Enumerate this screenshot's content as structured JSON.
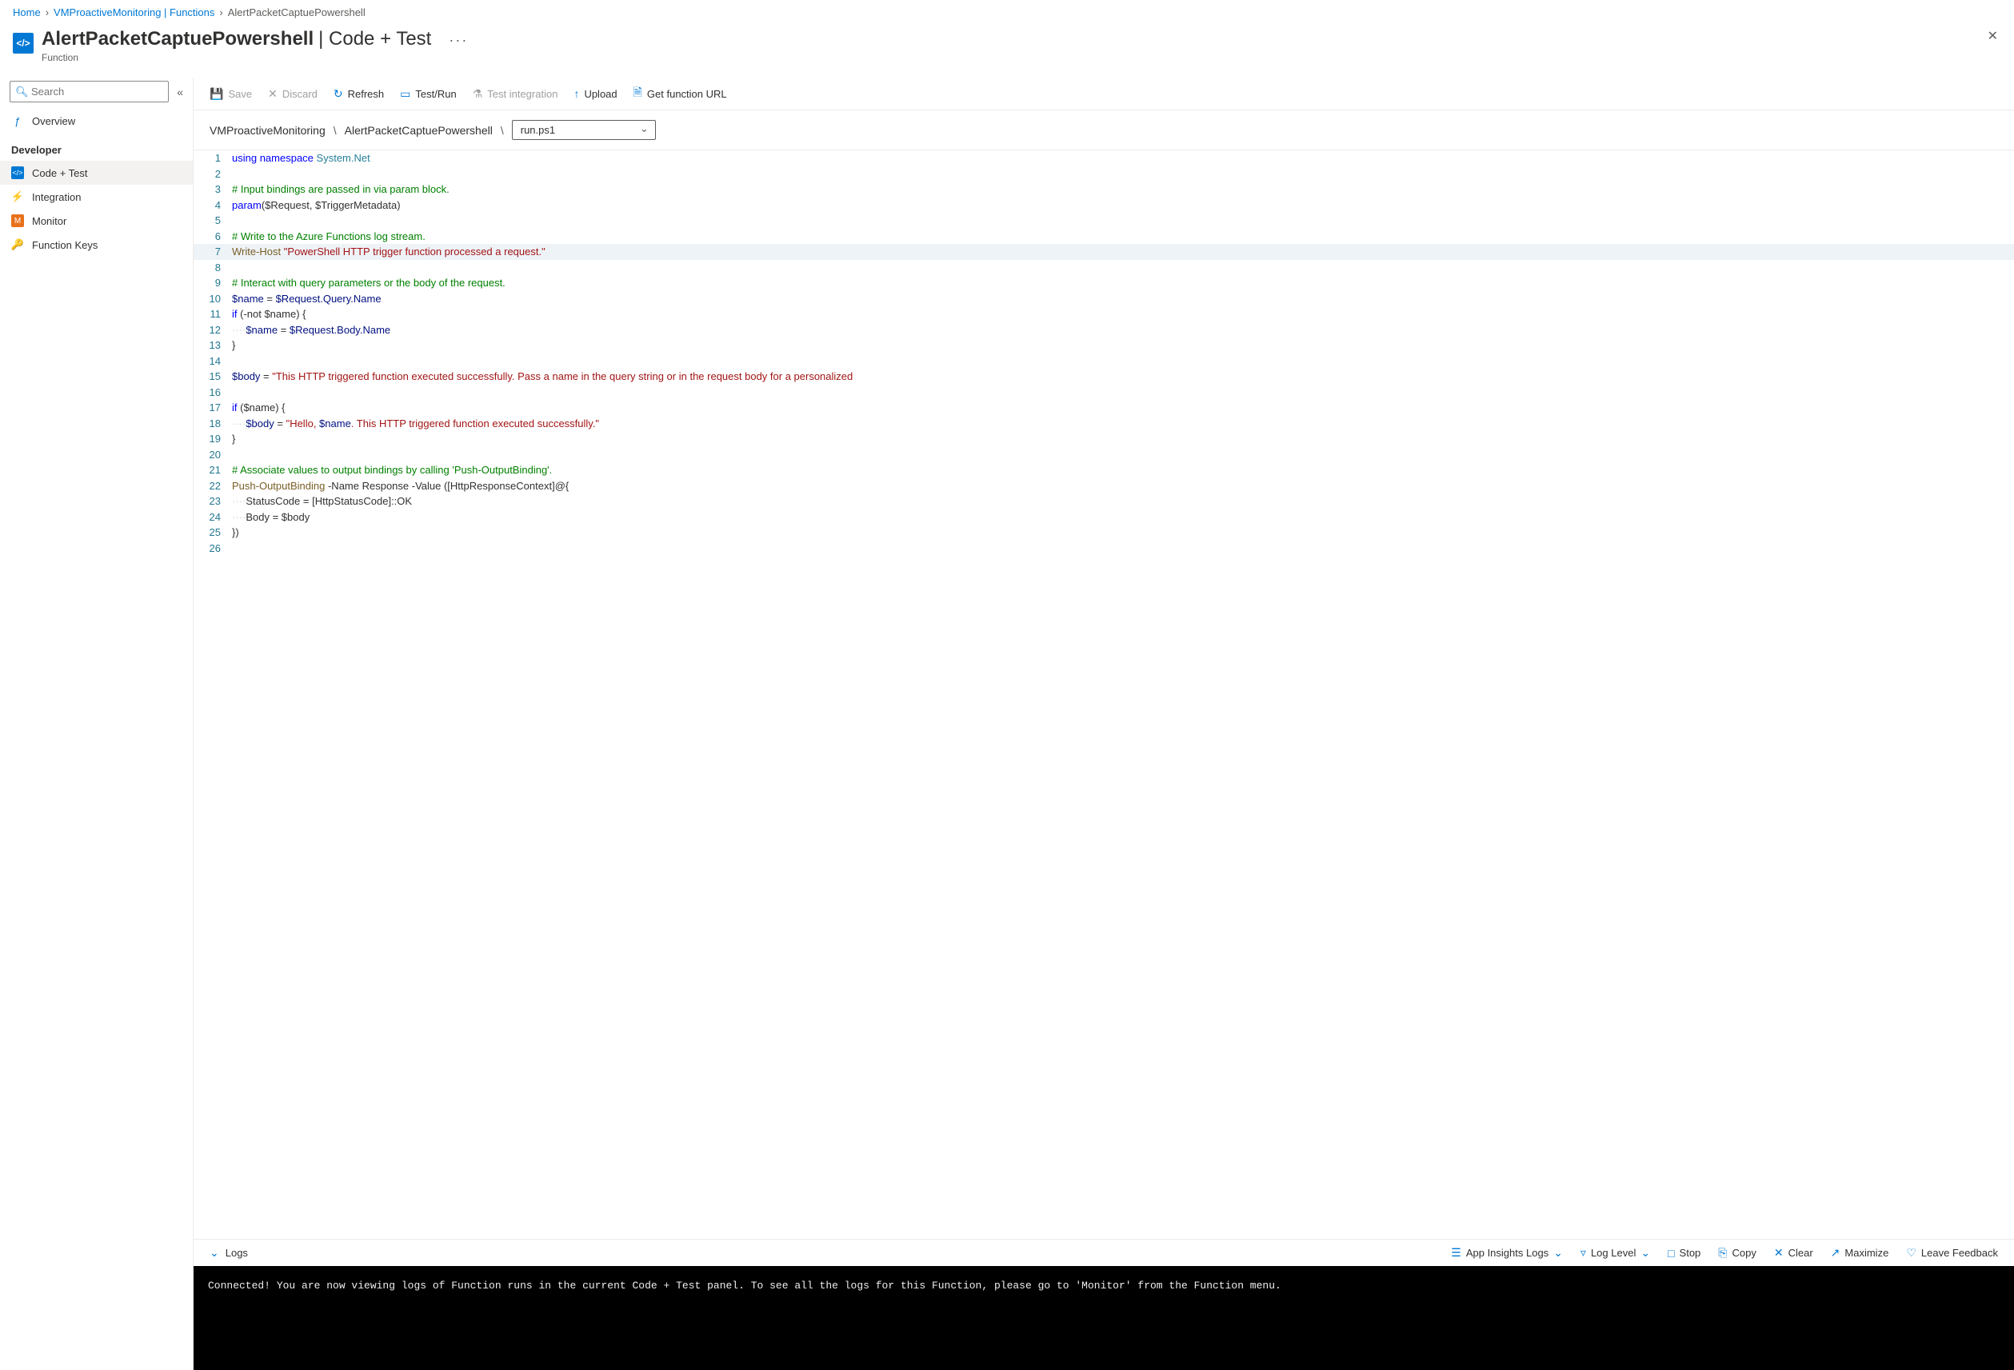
{
  "breadcrumb": {
    "home": "Home",
    "l1": "VMProactiveMonitoring | Functions",
    "current": "AlertPacketCaptuePowershell"
  },
  "header": {
    "title": "AlertPacketCaptuePowershell",
    "separator": " | ",
    "section": "Code + Test",
    "kind": "Function",
    "more": "···"
  },
  "sidebar": {
    "search_placeholder": "Search",
    "overview": "Overview",
    "group_dev": "Developer",
    "code_test": "Code + Test",
    "integration": "Integration",
    "monitor": "Monitor",
    "function_keys": "Function Keys"
  },
  "toolbar": {
    "save": "Save",
    "discard": "Discard",
    "refresh": "Refresh",
    "testrun": "Test/Run",
    "testint": "Test integration",
    "upload": "Upload",
    "geturl": "Get function URL"
  },
  "path": {
    "root": "VMProactiveMonitoring",
    "func": "AlertPacketCaptuePowershell",
    "file": "run.ps1"
  },
  "code": {
    "l1_kw": "using",
    "l1_kw2": "namespace",
    "l1_ns": "System.Net",
    "l3_cm": "# Input bindings are passed in via param block.",
    "l4_kw": "param",
    "l4_rest": "($Request, $TriggerMetadata)",
    "l6_cm": "# Write to the Azure Functions log stream.",
    "l7_fn": "Write-Host",
    "l7_str": "\"PowerShell HTTP trigger function processed a request.\"",
    "l9_cm": "# Interact with query parameters or the body of the request.",
    "l10_var": "$name",
    "l10_eq": " = ",
    "l10_rest": "$Request.Query.Name",
    "l11_kw": "if",
    "l11_rest": " (-not $name) {",
    "l12_indent": "····",
    "l12_var": "$name",
    "l12_eq": " = ",
    "l12_rest": "$Request.Body.Name",
    "l13": "}",
    "l15_var": "$body",
    "l15_eq": " = ",
    "l15_str": "\"This HTTP triggered function executed successfully. Pass a name in the query string or in the request body for a personalized",
    "l17_kw": "if",
    "l17_rest": " ($name) {",
    "l18_indent": "····",
    "l18_var": "$body",
    "l18_eq": " = ",
    "l18_str1": "\"Hello, ",
    "l18_var2": "$name",
    "l18_str2": ". This HTTP triggered function executed successfully.\"",
    "l19": "}",
    "l21_cm": "# Associate values to output bindings by calling 'Push-OutputBinding'.",
    "l22_fn": "Push-OutputBinding",
    "l22_rest": " -Name Response -Value ([HttpResponseContext]@{",
    "l23_indent": "····",
    "l23_rest": "StatusCode = [HttpStatusCode]::OK",
    "l24_indent": "····",
    "l24_rest": "Body = $body",
    "l25": "})"
  },
  "logsbar": {
    "logs": "Logs",
    "appinsights": "App Insights Logs",
    "loglevel": "Log Level",
    "stop": "Stop",
    "copy": "Copy",
    "clear": "Clear",
    "maximize": "Maximize",
    "feedback": "Leave Feedback"
  },
  "console": {
    "text": "Connected! You are now viewing logs of Function runs in the current Code + Test panel. To see all the logs for this Function, please go to 'Monitor' from the Function menu."
  }
}
